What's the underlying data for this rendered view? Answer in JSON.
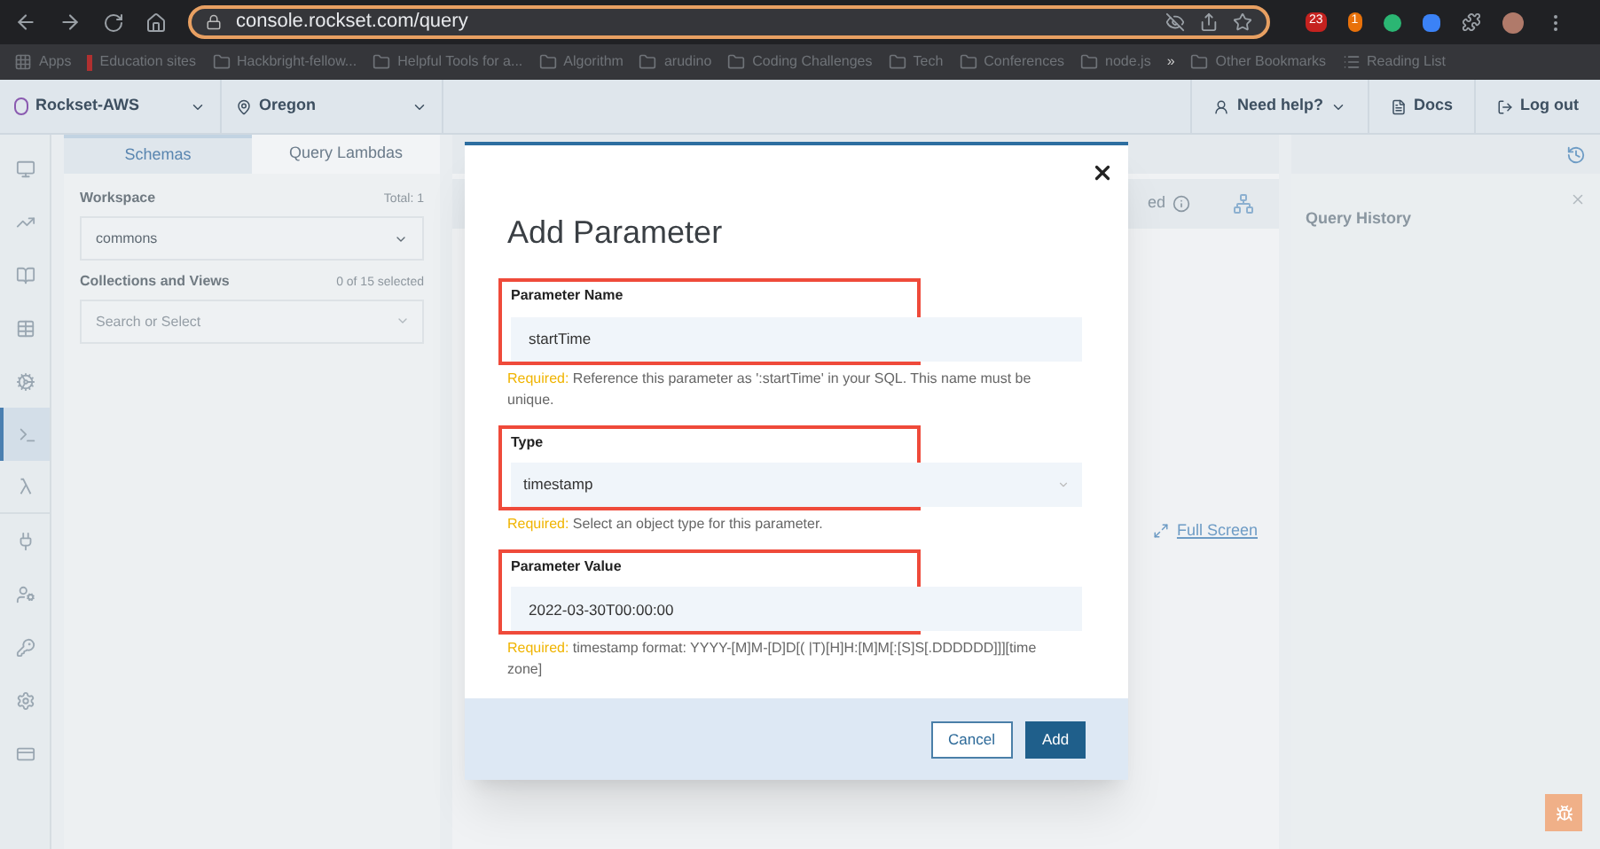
{
  "browser": {
    "url": "console.rockset.com/query",
    "extension_badges": [
      "23",
      "1"
    ],
    "bookmarks": [
      {
        "label": "Apps",
        "kind": "apps"
      },
      {
        "label": "Education sites",
        "kind": "link"
      },
      {
        "label": "Hackbright-fellow...",
        "kind": "folder"
      },
      {
        "label": "Helpful Tools for a...",
        "kind": "folder"
      },
      {
        "label": "Algorithm",
        "kind": "folder"
      },
      {
        "label": "arudino",
        "kind": "folder"
      },
      {
        "label": "Coding Challenges",
        "kind": "folder"
      },
      {
        "label": "Tech",
        "kind": "folder"
      },
      {
        "label": "Conferences",
        "kind": "folder"
      },
      {
        "label": "node.js",
        "kind": "folder"
      }
    ],
    "overflow": "»",
    "other_bookmarks": "Other Bookmarks",
    "reading_list": "Reading List"
  },
  "header": {
    "org": "Rockset-AWS",
    "region": "Oregon",
    "links": [
      {
        "label": "Need help?",
        "kind": "help"
      },
      {
        "label": "Docs",
        "kind": "docs"
      },
      {
        "label": "Log out",
        "kind": "logout"
      }
    ]
  },
  "nav": [
    {
      "kind": "monitor",
      "selected": false
    },
    {
      "kind": "chart",
      "selected": false
    },
    {
      "kind": "book",
      "selected": false
    },
    {
      "kind": "table",
      "selected": false
    },
    {
      "kind": "gear",
      "selected": false
    },
    {
      "kind": "terminal",
      "selected": true
    },
    {
      "kind": "lambda",
      "selected": false
    },
    {
      "kind": "plug",
      "selected": false
    },
    {
      "kind": "user",
      "selected": false
    },
    {
      "kind": "key",
      "selected": false
    },
    {
      "kind": "settings",
      "selected": false
    },
    {
      "kind": "card",
      "selected": false
    }
  ],
  "schema_panel": {
    "tabs": [
      {
        "label": "Schemas",
        "selected": true
      },
      {
        "label": "Query Lambdas",
        "selected": false
      }
    ],
    "workspace": {
      "label": "Workspace",
      "count": "Total: 1",
      "value": "commons"
    },
    "collections": {
      "label": "Collections and Views",
      "count": "0 of 15 selected",
      "placeholder": "Search or Select"
    }
  },
  "editor": {
    "label_fragment": "ed",
    "full_screen": "Full Screen"
  },
  "query_history": {
    "title": "Query History"
  },
  "dialog": {
    "title": "Add Parameter",
    "fields": [
      {
        "label": "Parameter Name",
        "kind": "text",
        "value": "startTime",
        "highlighted": true,
        "required": "Required:",
        "help": "Reference this parameter as ':startTime' in your SQL. This name must be unique."
      },
      {
        "label": "Type",
        "kind": "select",
        "value": "timestamp",
        "highlighted": true,
        "required": "Required:",
        "help": "Select an object type for this parameter."
      },
      {
        "label": "Parameter Value",
        "kind": "text",
        "value": "2022-03-30T00:00:00",
        "highlighted": true,
        "required": "Required:",
        "help": "timestamp format: YYYY-[M]M-[D]D[( |T)[H]H:[M]M[:[S]S[.DDDDDD]]][time zone]"
      }
    ],
    "buttons": [
      {
        "label": "Cancel",
        "kind": "secondary"
      },
      {
        "label": "Add",
        "kind": "primary"
      }
    ]
  }
}
